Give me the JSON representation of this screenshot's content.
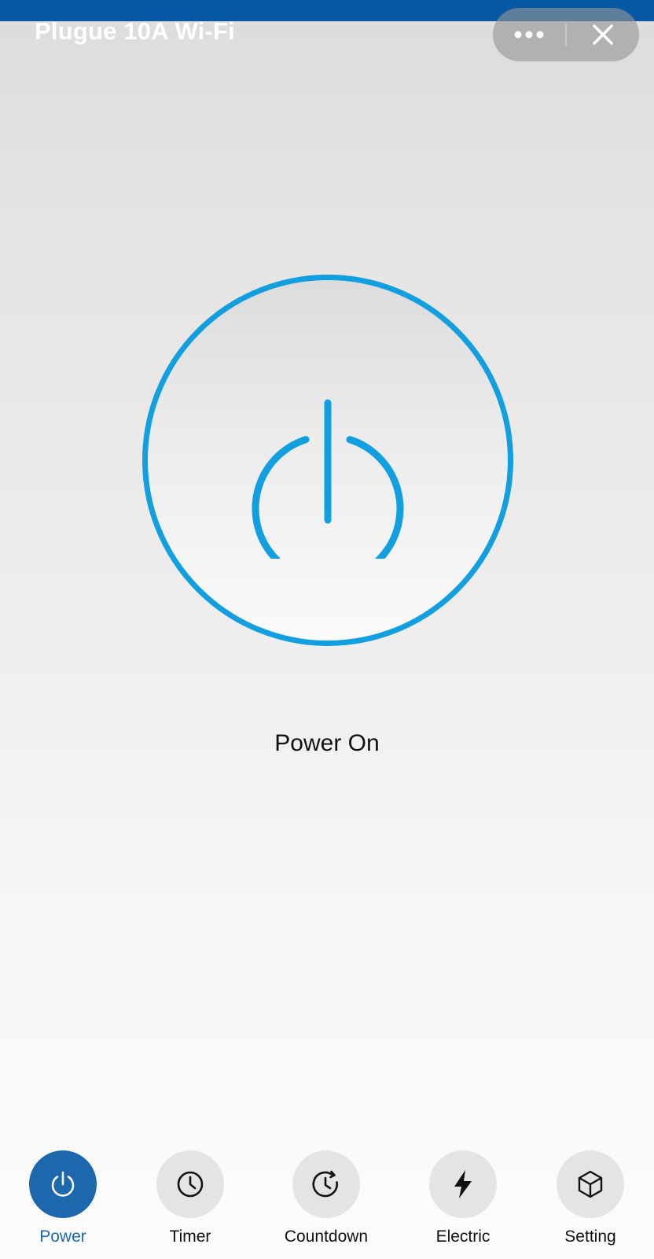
{
  "header": {
    "title": "Plugue 10A Wi-Fi",
    "more_icon": "more-dots-icon",
    "close_icon": "close-icon"
  },
  "power": {
    "status_label": "Power On",
    "icon": "power-icon",
    "ring_color": "#129fdf"
  },
  "colors": {
    "top_strip": "#0758a3",
    "active_nav": "#1d67ad",
    "inactive_nav_bg": "#e4e4e4"
  },
  "nav": {
    "items": [
      {
        "label": "Power",
        "icon": "power-icon",
        "active": true
      },
      {
        "label": "Timer",
        "icon": "clock-icon",
        "active": false
      },
      {
        "label": "Countdown",
        "icon": "countdown-icon",
        "active": false
      },
      {
        "label": "Electric",
        "icon": "lightning-icon",
        "active": false
      },
      {
        "label": "Setting",
        "icon": "cube-icon",
        "active": false
      }
    ]
  }
}
